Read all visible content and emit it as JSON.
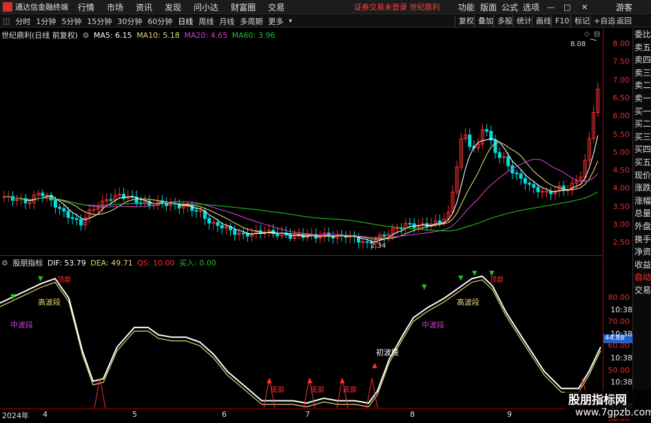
{
  "menubar": {
    "app_title": "通达信金融终端",
    "menus": [
      "行情",
      "市场",
      "资讯",
      "发现",
      "问小达",
      "财富圈",
      "交易"
    ],
    "warning": "证券交易未登录  世纪鼎利",
    "right_menus": [
      "功能",
      "版面",
      "公式",
      "选项"
    ],
    "guest": "游客"
  },
  "toolbar": {
    "periods": [
      "分时",
      "1分钟",
      "5分钟",
      "15分钟",
      "30分钟",
      "60分钟",
      "日线",
      "周线",
      "月线",
      "多周期",
      "更多"
    ],
    "active": "日线",
    "right_buttons": [
      "复权",
      "叠加",
      "多股",
      "统计",
      "画线",
      "F10",
      "标记",
      "+自选",
      "返回"
    ]
  },
  "main_legend": {
    "stock": "世纪鼎利(日线 前复权)",
    "ma5": "MA5: 6.15",
    "ma10": "MA10: 5.18",
    "ma20": "MA20: 4.65",
    "ma60": "MA60: 3.96"
  },
  "sub_legend": {
    "name": "股朋指标",
    "dif": "DIF: 53.79",
    "dea": "DEA: 49.71",
    "qs": "QS: 10.00",
    "buy": "买入: 0.00"
  },
  "colors": {
    "ma5": "#ffffff",
    "ma10": "#e8d870",
    "ma20": "#d040d0",
    "ma60": "#20c020",
    "up": "#ff3030",
    "down": "#00e0e0",
    "axis": "#b00000"
  },
  "price_axis": [
    "8.00",
    "7.50",
    "7.00",
    "6.50",
    "6.00",
    "5.50",
    "5.00",
    "4.50",
    "4.00",
    "3.50",
    "3.00",
    "2.50"
  ],
  "sub_axis": [
    "80.00",
    "10:38",
    "70.00",
    "10:38",
    "60.00",
    "10:38",
    "50.00",
    "10:38",
    "40.00",
    "10:38",
    "30.00"
  ],
  "sub_current": "44.88",
  "annotations": {
    "high": "8.08",
    "low": "2.34",
    "labels": [
      {
        "text": "高波段",
        "color": "#e8d870"
      },
      {
        "text": "中波段",
        "color": "#d040d0"
      },
      {
        "text": "初波段",
        "color": "#ffffff"
      },
      {
        "text": "中波段",
        "color": "#d040d0"
      },
      {
        "text": "高波段",
        "color": "#e8d870"
      },
      {
        "text": "顶部",
        "color": "#ff3030"
      },
      {
        "text": "顶部",
        "color": "#ff3030"
      },
      {
        "text": "底部",
        "color": "#ff3030"
      },
      {
        "text": "底部",
        "color": "#ff3030"
      },
      {
        "text": "底部",
        "color": "#ff3030"
      }
    ]
  },
  "dates": [
    "2024年",
    "4",
    "5",
    "6",
    "7",
    "8",
    "9"
  ],
  "side_tabs": [
    "委比",
    "卖五",
    "卖四",
    "卖三",
    "卖二",
    "卖一",
    "买一",
    "买二",
    "买三",
    "买四",
    "买五",
    "现价",
    "涨跌",
    "涨幅",
    "总量",
    "外盘",
    "换手",
    "净资",
    "收益",
    "自动",
    "交易"
  ],
  "watermark": {
    "line1": "股朋指标网",
    "line2": "www.7gpzb.com"
  }
}
